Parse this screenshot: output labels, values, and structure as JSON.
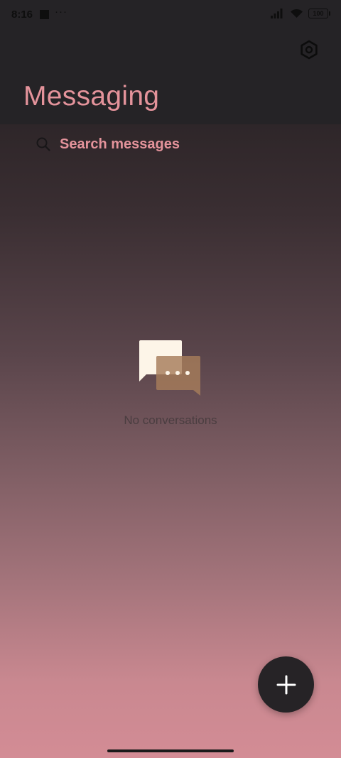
{
  "status_bar": {
    "time": "8:16",
    "dots": "···",
    "battery_level": "100"
  },
  "header": {
    "title": "Messaging",
    "settings_icon": "hexagon-settings-icon"
  },
  "search": {
    "placeholder": "Search messages",
    "icon": "search-icon"
  },
  "empty_state": {
    "icon": "chat-bubbles-icon",
    "message": "No conversations"
  },
  "fab": {
    "icon": "plus-icon"
  },
  "colors": {
    "accent": "#e4939b",
    "header_bg": "#252326",
    "fab_bg": "#262326",
    "bubble_front": "#fdf5e8",
    "bubble_back": "#a67c5a"
  }
}
